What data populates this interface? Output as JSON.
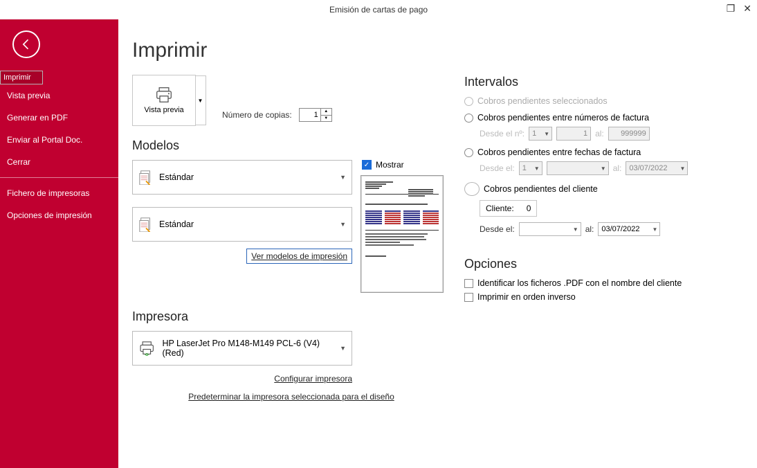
{
  "window": {
    "title": "Emisión de cartas de pago"
  },
  "sidebar": {
    "items": [
      {
        "label": "Imprimir"
      },
      {
        "label": "Vista previa"
      },
      {
        "label": "Generar en PDF"
      },
      {
        "label": "Enviar al Portal Doc."
      },
      {
        "label": "Cerrar"
      }
    ],
    "items2": [
      {
        "label": "Fichero de impresoras"
      },
      {
        "label": "Opciones de impresión"
      }
    ]
  },
  "page": {
    "heading": "Imprimir",
    "vista_previa": "Vista previa",
    "copies_label": "Número de copias:",
    "copies_value": "1"
  },
  "modelos": {
    "heading": "Modelos",
    "model1": "Estándar",
    "model2": "Estándar",
    "link": "Ver modelos de impresión",
    "mostrar": "Mostrar"
  },
  "impresora": {
    "heading": "Impresora",
    "name": "HP LaserJet Pro M148-M149 PCL-6 (V4) (Red)",
    "link1": "Configurar impresora",
    "link2": "Predeterminar la impresora seleccionada para el diseño"
  },
  "intervalos": {
    "heading": "Intervalos",
    "r1": "Cobros pendientes seleccionados",
    "r2": "Cobros pendientes entre números de factura",
    "r2_desde": "Desde el nº:",
    "r2_serie": "1",
    "r2_num1": "1",
    "r2_al": "al:",
    "r2_num2": "999999",
    "r3": "Cobros pendientes entre fechas de factura",
    "r3_desde": "Desde el:",
    "r3_serie": "1",
    "r3_al": "al:",
    "r3_date": "03/07/2022",
    "r4": "Cobros pendientes del cliente",
    "r4_cliente_lbl": "Cliente:",
    "r4_cliente_val": "0",
    "r4_desde": "Desde el:",
    "r4_al": "al:",
    "r4_date": "03/07/2022"
  },
  "opciones": {
    "heading": "Opciones",
    "o1": "Identificar los ficheros .PDF con el nombre del cliente",
    "o2": "Imprimir en orden inverso"
  }
}
